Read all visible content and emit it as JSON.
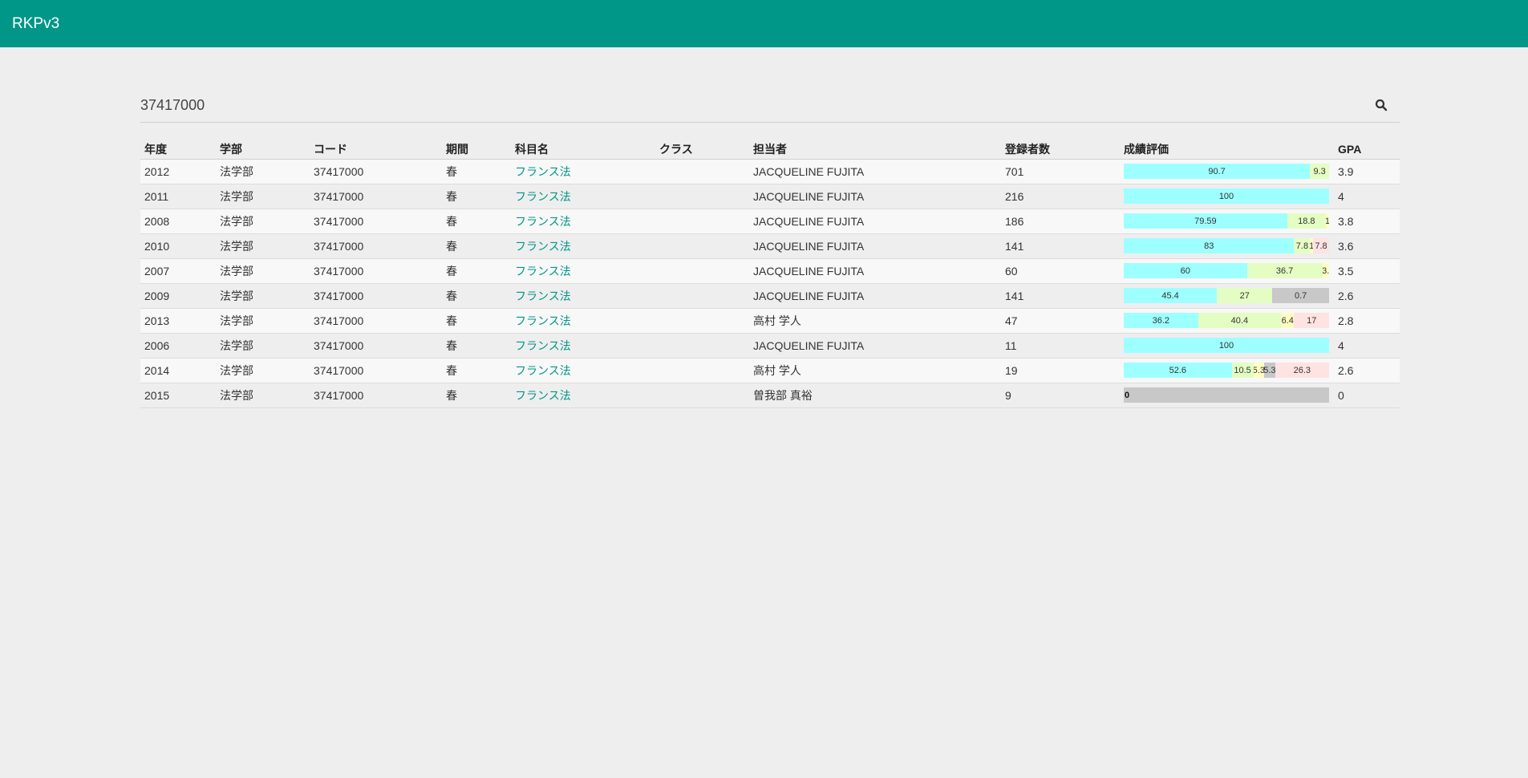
{
  "app": {
    "title": "RKPv3"
  },
  "search": {
    "value": "37417000",
    "icon": "search-icon"
  },
  "grade_colors": {
    "A": "#9effff",
    "B": "#e4fdc3",
    "C": "#fdfdc3",
    "D": "#ffe2e2",
    "F": "#c8c8c8"
  },
  "table": {
    "headers": [
      "年度",
      "学部",
      "コード",
      "期間",
      "科目名",
      "クラス",
      "担当者",
      "登録者数",
      "成績評価",
      "GPA"
    ],
    "rows": [
      {
        "year": "2012",
        "faculty": "法学部",
        "code": "37417000",
        "term": "春",
        "subject": "フランス法",
        "class": "",
        "instructor": "JACQUELINE FUJITA",
        "enrolled": "701",
        "gpa": "3.9",
        "grades": [
          {
            "grade": "A",
            "pct": 90.7,
            "label": "90.7"
          },
          {
            "grade": "B",
            "pct": 9.3,
            "label": "9.3"
          }
        ]
      },
      {
        "year": "2011",
        "faculty": "法学部",
        "code": "37417000",
        "term": "春",
        "subject": "フランス法",
        "class": "",
        "instructor": "JACQUELINE FUJITA",
        "enrolled": "216",
        "gpa": "4",
        "grades": [
          {
            "grade": "A",
            "pct": 100,
            "label": "100"
          }
        ]
      },
      {
        "year": "2008",
        "faculty": "法学部",
        "code": "37417000",
        "term": "春",
        "subject": "フランス法",
        "class": "",
        "instructor": "JACQUELINE FUJITA",
        "enrolled": "186",
        "gpa": "3.8",
        "grades": [
          {
            "grade": "A",
            "pct": 79.59,
            "label": "79.59"
          },
          {
            "grade": "B",
            "pct": 18.8,
            "label": "18.8"
          },
          {
            "grade": "C",
            "pct": 1.61,
            "label": "1"
          }
        ]
      },
      {
        "year": "2010",
        "faculty": "法学部",
        "code": "37417000",
        "term": "春",
        "subject": "フランス法",
        "class": "",
        "instructor": "JACQUELINE FUJITA",
        "enrolled": "141",
        "gpa": "3.6",
        "grades": [
          {
            "grade": "A",
            "pct": 83,
            "label": "83"
          },
          {
            "grade": "B",
            "pct": 7.8,
            "label": "7.8"
          },
          {
            "grade": "C",
            "pct": 1.4,
            "label": "1"
          },
          {
            "grade": "D",
            "pct": 7.8,
            "label": "7.8"
          }
        ]
      },
      {
        "year": "2007",
        "faculty": "法学部",
        "code": "37417000",
        "term": "春",
        "subject": "フランス法",
        "class": "",
        "instructor": "JACQUELINE FUJITA",
        "enrolled": "60",
        "gpa": "3.5",
        "grades": [
          {
            "grade": "A",
            "pct": 60,
            "label": "60"
          },
          {
            "grade": "B",
            "pct": 36.7,
            "label": "36.7"
          },
          {
            "grade": "C",
            "pct": 3.3,
            "label": "3."
          }
        ]
      },
      {
        "year": "2009",
        "faculty": "法学部",
        "code": "37417000",
        "term": "春",
        "subject": "フランス法",
        "class": "",
        "instructor": "JACQUELINE FUJITA",
        "enrolled": "141",
        "gpa": "2.6",
        "grades": [
          {
            "grade": "A",
            "pct": 45.4,
            "label": "45.4"
          },
          {
            "grade": "B",
            "pct": 27,
            "label": "27"
          },
          {
            "grade": "F",
            "pct": 27.6,
            "label": "0.7"
          }
        ]
      },
      {
        "year": "2013",
        "faculty": "法学部",
        "code": "37417000",
        "term": "春",
        "subject": "フランス法",
        "class": "",
        "instructor": "高村 学人",
        "enrolled": "47",
        "gpa": "2.8",
        "grades": [
          {
            "grade": "A",
            "pct": 36.2,
            "label": "36.2"
          },
          {
            "grade": "B",
            "pct": 40.4,
            "label": "40.4"
          },
          {
            "grade": "C",
            "pct": 6.4,
            "label": "6.4"
          },
          {
            "grade": "D",
            "pct": 17,
            "label": "17"
          }
        ]
      },
      {
        "year": "2006",
        "faculty": "法学部",
        "code": "37417000",
        "term": "春",
        "subject": "フランス法",
        "class": "",
        "instructor": "JACQUELINE FUJITA",
        "enrolled": "11",
        "gpa": "4",
        "grades": [
          {
            "grade": "A",
            "pct": 100,
            "label": "100"
          }
        ]
      },
      {
        "year": "2014",
        "faculty": "法学部",
        "code": "37417000",
        "term": "春",
        "subject": "フランス法",
        "class": "",
        "instructor": "高村 学人",
        "enrolled": "19",
        "gpa": "2.6",
        "grades": [
          {
            "grade": "A",
            "pct": 52.6,
            "label": "52.6"
          },
          {
            "grade": "B",
            "pct": 10.5,
            "label": "10.5"
          },
          {
            "grade": "C",
            "pct": 5.3,
            "label": "5.3"
          },
          {
            "grade": "F",
            "pct": 5.3,
            "label": "5.3"
          },
          {
            "grade": "D",
            "pct": 26.3,
            "label": "26.3"
          }
        ]
      },
      {
        "year": "2015",
        "faculty": "法学部",
        "code": "37417000",
        "term": "春",
        "subject": "フランス法",
        "class": "",
        "instructor": "曽我部 真裕",
        "enrolled": "9",
        "gpa": "0",
        "grades": [
          {
            "grade": "F",
            "pct": 100,
            "label": "0",
            "zero": true
          }
        ]
      }
    ]
  }
}
